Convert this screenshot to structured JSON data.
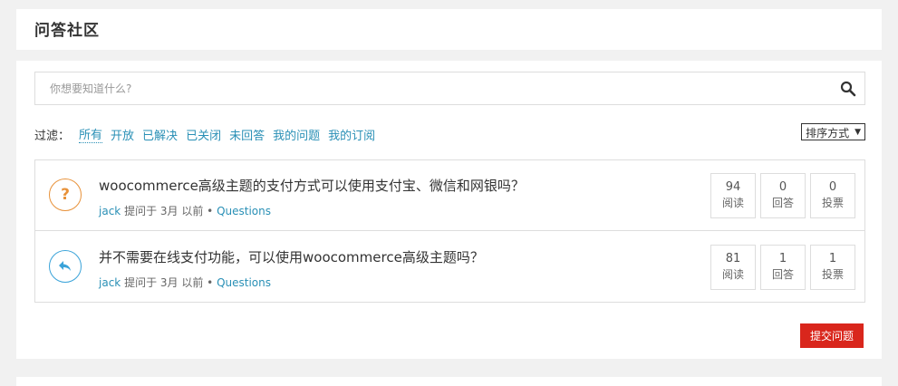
{
  "page_title": "问答社区",
  "search": {
    "placeholder": "你想要知道什么?"
  },
  "filters": {
    "label": "过滤：",
    "items": [
      "所有",
      "开放",
      "已解决",
      "已关闭",
      "未回答",
      "我的问题",
      "我的订阅"
    ],
    "active_index": 0
  },
  "sort": {
    "label": "排序方式"
  },
  "questions": [
    {
      "icon": "question-mark-icon",
      "title": "woocommerce高级主题的支付方式可以使用支付宝、微信和网银吗？",
      "author": "jack",
      "meta_text": "提问于 3月 以前 •",
      "category": "Questions",
      "stats": [
        {
          "value": "94",
          "label": "阅读"
        },
        {
          "value": "0",
          "label": "回答"
        },
        {
          "value": "0",
          "label": "投票"
        }
      ]
    },
    {
      "icon": "reply-arrow-icon",
      "title": "并不需要在线支付功能，可以使用woocommerce高级主题吗？",
      "author": "jack",
      "meta_text": "提问于 3月 以前 •",
      "category": "Questions",
      "stats": [
        {
          "value": "81",
          "label": "阅读"
        },
        {
          "value": "1",
          "label": "回答"
        },
        {
          "value": "1",
          "label": "投票"
        }
      ]
    }
  ],
  "submit_button": "提交问题",
  "colors": {
    "link": "#2a90b6",
    "question_icon": "#e8923a",
    "reply_icon": "#3aa3d9",
    "submit": "#d9261c"
  }
}
